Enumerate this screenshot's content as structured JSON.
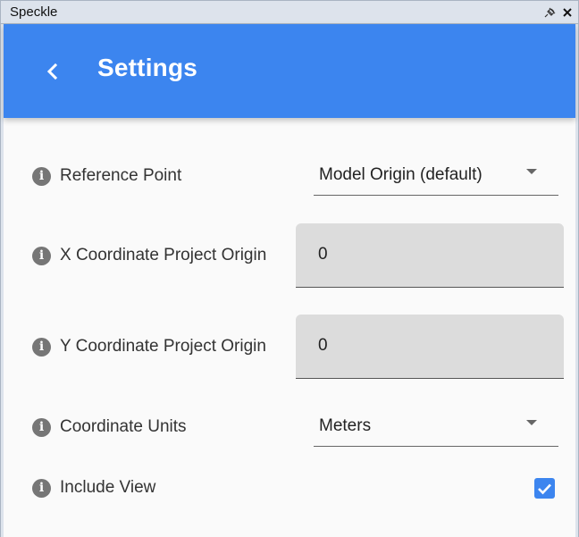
{
  "panel": {
    "title": "Speckle",
    "pin_icon": "pin-icon",
    "close_label": "✕"
  },
  "header": {
    "title": "Settings",
    "back_icon": "chevron-left-icon",
    "background_color": "#3c85ef"
  },
  "settings": {
    "reference_point": {
      "label": "Reference Point",
      "value": "Model Origin (default)"
    },
    "x_coordinate": {
      "label": "X Coordinate Project Origin",
      "value": "0"
    },
    "y_coordinate": {
      "label": "Y Coordinate Project Origin",
      "value": "0"
    },
    "coordinate_units": {
      "label": "Coordinate Units",
      "value": "Meters"
    },
    "include_view": {
      "label": "Include View",
      "checked": true
    }
  },
  "info_icon_glyph": "i"
}
